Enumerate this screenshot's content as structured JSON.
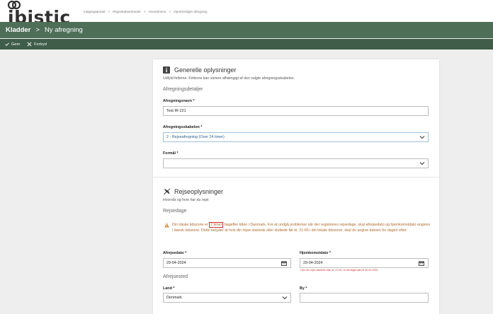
{
  "brand": {
    "logo_text": "ibistic"
  },
  "breadcrumbs": [
    "Indgangsportal",
    ">",
    "Regnskabsenheder",
    ">",
    "Hovedmenu",
    ">",
    "Opret/redigér afregning"
  ],
  "titlebar": {
    "section": "Kladder",
    "separator": ">",
    "current": "Ny afregning"
  },
  "toolbar": {
    "save_label": "Gem",
    "discard_label": "Fortryd"
  },
  "general": {
    "title": "Generelle oplysninger",
    "subtitle": "Udfyld felterne. Felterne kan variere afhængigt af den valgte afregningsskabelon.",
    "group_label": "Afregningsdetaljer",
    "name_label": "Afregningsnavn *",
    "name_value": "Test IR-221",
    "template_label": "Afregningsskabelon *",
    "template_value": "2 - Rejseafregning (Over 24 timer)",
    "purpose_label": "Formål *",
    "purpose_value": ""
  },
  "travel": {
    "title": "Rejseoplysninger",
    "subtitle": "Hvornår og hvor har du rejst",
    "dates_group": "Rejsedage",
    "warning_pre": "Din lokale tidszone er",
    "warning_highlight": "2 timer",
    "warning_post": "bagefter tiden i Danmark. For at undgå problemer når der registreres rejsedage, skal afrejsedato og hjemkomstdato angives i dansk tidszone. Dette betyder at hvis din rejse startede eller sluttede før kl. 21:00 i din lokale tidszone, skal du angive datoen for dagen efter.",
    "depart_label": "Afrejsedato *",
    "depart_value": "29-04-2024",
    "return_label": "Hjemkomstdato *",
    "return_value": "29-04-2024",
    "return_error": "Hvis din rejse startede efter kl. 21:00, vil værdigst dato til 30-04-2024",
    "origin_group": "Afrejsested",
    "country_label": "Land *",
    "country_value": "Denmark",
    "city_label": "By *",
    "city_value": ""
  },
  "colors": {
    "titlebar": "#4e6e58",
    "toolbar": "#3f5d48",
    "warning": "#b06a2c",
    "error": "#c83232",
    "selected_border": "#9ec0dd"
  }
}
